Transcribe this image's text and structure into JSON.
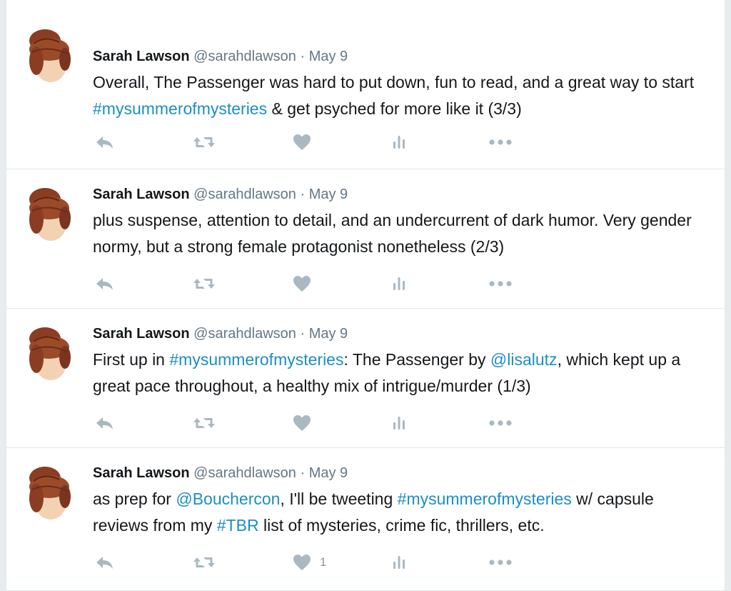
{
  "tweets": [
    {
      "name": "Sarah Lawson",
      "handle": "@sarahdlawson",
      "dot": "·",
      "time": "May 9",
      "text": [
        {
          "t": "Overall, The Passenger was hard to put down, fun to read, and a great way to start "
        },
        {
          "t": "#mysummerofmysteries",
          "link": true
        },
        {
          "t": " & get psyched for more like it (3/3)"
        }
      ],
      "likes": ""
    },
    {
      "name": "Sarah Lawson",
      "handle": "@sarahdlawson",
      "dot": "·",
      "time": "May 9",
      "text": [
        {
          "t": "plus suspense, attention to detail, and an undercurrent of dark humor. Very gender normy, but a strong female protagonist nonetheless (2/3)"
        }
      ],
      "likes": ""
    },
    {
      "name": "Sarah Lawson",
      "handle": "@sarahdlawson",
      "dot": "·",
      "time": "May 9",
      "text": [
        {
          "t": "First up in "
        },
        {
          "t": "#mysummerofmysteries",
          "link": true
        },
        {
          "t": ": The Passenger by "
        },
        {
          "t": "@lisalutz",
          "link": true
        },
        {
          "t": ", which kept up a great pace throughout, a healthy mix of intrigue/murder (1/3)"
        }
      ],
      "likes": ""
    },
    {
      "name": "Sarah Lawson",
      "handle": "@sarahdlawson",
      "dot": "·",
      "time": "May 9",
      "text": [
        {
          "t": "as prep for "
        },
        {
          "t": "@Bouchercon",
          "link": true
        },
        {
          "t": ", I'll be tweeting "
        },
        {
          "t": "#mysummerofmysteries",
          "link": true
        },
        {
          "t": " w/ capsule reviews from my "
        },
        {
          "t": "#TBR",
          "link": true
        },
        {
          "t": " list of mysteries, crime fic, thrillers, etc."
        }
      ],
      "likes": "1"
    }
  ],
  "icons": {
    "reply": "reply-icon",
    "retweet": "retweet-icon",
    "like": "heart-icon",
    "analytics": "analytics-icon",
    "more": "more-icon"
  },
  "colors": {
    "link": "#1c8ec4",
    "icon": "#aab8c2",
    "meta": "#657786",
    "border": "#e1e8ed"
  }
}
